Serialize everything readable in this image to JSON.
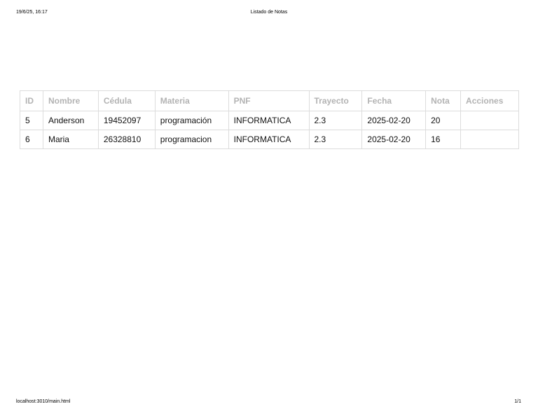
{
  "print_header": {
    "datetime": "19/6/25, 16:17",
    "title": "Listado de Notas"
  },
  "print_footer": {
    "url": "localhost:3010/main.html",
    "page": "1/1"
  },
  "table": {
    "headers": [
      "ID",
      "Nombre",
      "Cédula",
      "Materia",
      "PNF",
      "Trayecto",
      "Fecha",
      "Nota",
      "Acciones"
    ],
    "rows": [
      [
        "5",
        "Anderson",
        "19452097",
        "programación",
        "INFORMATICA",
        "2.3",
        "2025-02-20",
        "20",
        ""
      ],
      [
        "6",
        "Maria",
        "26328810",
        "programacion",
        "INFORMATICA",
        "2.3",
        "2025-02-20",
        "16",
        ""
      ]
    ]
  }
}
